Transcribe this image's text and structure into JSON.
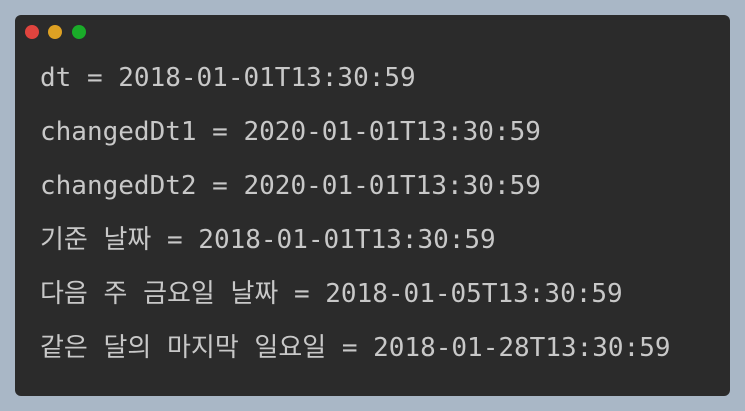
{
  "window": {
    "controls": [
      {
        "name": "close",
        "color": "#e0443e"
      },
      {
        "name": "minimize",
        "color": "#dea123"
      },
      {
        "name": "maximize",
        "color": "#1aab29"
      }
    ]
  },
  "console": {
    "lines": [
      "dt = 2018-01-01T13:30:59",
      "changedDt1 = 2020-01-01T13:30:59",
      "changedDt2 = 2020-01-01T13:30:59",
      "기준 날짜 = 2018-01-01T13:30:59",
      "다음 주 금요일 날짜 = 2018-01-05T13:30:59",
      "같은 달의 마지막 일요일 = 2018-01-28T13:30:59"
    ]
  }
}
